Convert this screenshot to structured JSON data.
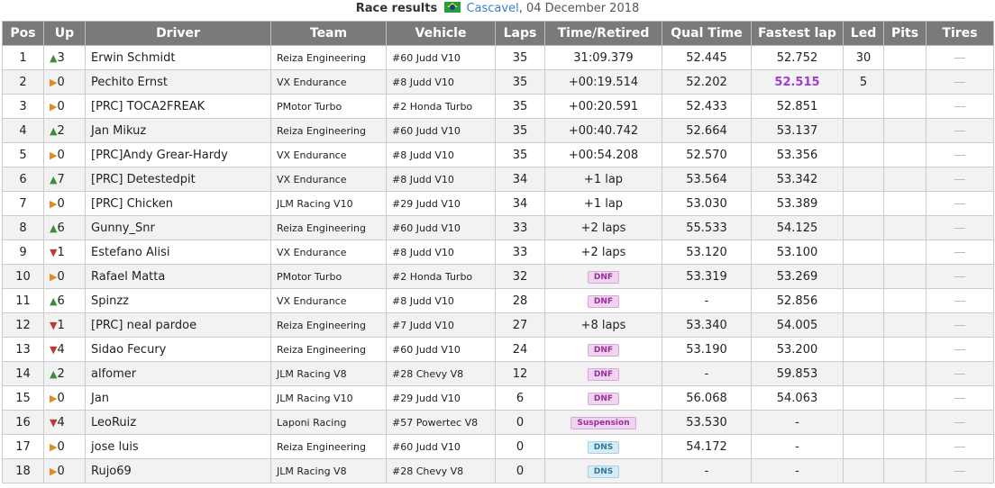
{
  "caption": {
    "title": "Race results",
    "track": "Cascavel",
    "date": ", 04 December 2018"
  },
  "headers": [
    "Pos",
    "Up",
    "Driver",
    "Team",
    "Vehicle",
    "Laps",
    "Time/Retired",
    "Qual Time",
    "Fastest lap",
    "Led",
    "Pits",
    "Tires"
  ],
  "colors": {
    "header_bg": "#7a7a7a",
    "up": "#3a8e3a",
    "down": "#c0392b",
    "same": "#e08a1e",
    "fastest": "#a23bd6"
  },
  "rows": [
    {
      "pos": "1",
      "dir": "up",
      "change": "3",
      "driver": "Erwin Schmidt",
      "team": "Reiza Engineering",
      "vehicle": "#60 Judd V10",
      "laps": "35",
      "time": "31:09.379",
      "badge": "",
      "qual": "52.445",
      "fastest": "52.752",
      "fastest_best": false,
      "led": "30",
      "pits": "",
      "tires": "—"
    },
    {
      "pos": "2",
      "dir": "same",
      "change": "0",
      "driver": "Pechito Ernst",
      "team": "VX Endurance",
      "vehicle": "#8 Judd V10",
      "laps": "35",
      "time": "+00:19.514",
      "badge": "",
      "qual": "52.202",
      "fastest": "52.515",
      "fastest_best": true,
      "led": "5",
      "pits": "",
      "tires": "—"
    },
    {
      "pos": "3",
      "dir": "same",
      "change": "0",
      "driver": "[PRC] TOCA2FREAK",
      "team": "PMotor Turbo",
      "vehicle": "#2 Honda Turbo",
      "laps": "35",
      "time": "+00:20.591",
      "badge": "",
      "qual": "52.433",
      "fastest": "52.851",
      "fastest_best": false,
      "led": "",
      "pits": "",
      "tires": "—"
    },
    {
      "pos": "4",
      "dir": "up",
      "change": "2",
      "driver": "Jan Mikuz",
      "team": "Reiza Engineering",
      "vehicle": "#60 Judd V10",
      "laps": "35",
      "time": "+00:40.742",
      "badge": "",
      "qual": "52.664",
      "fastest": "53.137",
      "fastest_best": false,
      "led": "",
      "pits": "",
      "tires": "—"
    },
    {
      "pos": "5",
      "dir": "same",
      "change": "0",
      "driver": "[PRC]Andy Grear-Hardy",
      "team": "VX Endurance",
      "vehicle": "#8 Judd V10",
      "laps": "35",
      "time": "+00:54.208",
      "badge": "",
      "qual": "52.570",
      "fastest": "53.356",
      "fastest_best": false,
      "led": "",
      "pits": "",
      "tires": "—"
    },
    {
      "pos": "6",
      "dir": "up",
      "change": "7",
      "driver": "[PRC] Detestedpit",
      "team": "VX Endurance",
      "vehicle": "#8 Judd V10",
      "laps": "34",
      "time": "+1 lap",
      "badge": "",
      "qual": "53.564",
      "fastest": "53.342",
      "fastest_best": false,
      "led": "",
      "pits": "",
      "tires": "—"
    },
    {
      "pos": "7",
      "dir": "same",
      "change": "0",
      "driver": "[PRC] Chicken",
      "team": "JLM Racing V10",
      "vehicle": "#29 Judd V10",
      "laps": "34",
      "time": "+1 lap",
      "badge": "",
      "qual": "53.030",
      "fastest": "53.389",
      "fastest_best": false,
      "led": "",
      "pits": "",
      "tires": "—"
    },
    {
      "pos": "8",
      "dir": "up",
      "change": "6",
      "driver": "Gunny_Snr",
      "team": "Reiza Engineering",
      "vehicle": "#60 Judd V10",
      "laps": "33",
      "time": "+2 laps",
      "badge": "",
      "qual": "55.533",
      "fastest": "54.125",
      "fastest_best": false,
      "led": "",
      "pits": "",
      "tires": "—"
    },
    {
      "pos": "9",
      "dir": "down",
      "change": "1",
      "driver": "Estefano Alisi",
      "team": "VX Endurance",
      "vehicle": "#8 Judd V10",
      "laps": "33",
      "time": "+2 laps",
      "badge": "",
      "qual": "53.120",
      "fastest": "53.100",
      "fastest_best": false,
      "led": "",
      "pits": "",
      "tires": "—"
    },
    {
      "pos": "10",
      "dir": "same",
      "change": "0",
      "driver": "Rafael Matta",
      "team": "PMotor Turbo",
      "vehicle": "#2 Honda Turbo",
      "laps": "32",
      "time": "",
      "badge": "DNF",
      "qual": "53.319",
      "fastest": "53.269",
      "fastest_best": false,
      "led": "",
      "pits": "",
      "tires": "—"
    },
    {
      "pos": "11",
      "dir": "up",
      "change": "6",
      "driver": "Spinzz",
      "team": "VX Endurance",
      "vehicle": "#8 Judd V10",
      "laps": "28",
      "time": "",
      "badge": "DNF",
      "qual": "-",
      "fastest": "52.856",
      "fastest_best": false,
      "led": "",
      "pits": "",
      "tires": "—"
    },
    {
      "pos": "12",
      "dir": "down",
      "change": "1",
      "driver": "[PRC] neal pardoe",
      "team": "Reiza Engineering",
      "vehicle": "#7 Judd V10",
      "laps": "27",
      "time": "+8 laps",
      "badge": "",
      "qual": "53.340",
      "fastest": "54.005",
      "fastest_best": false,
      "led": "",
      "pits": "",
      "tires": "—"
    },
    {
      "pos": "13",
      "dir": "down",
      "change": "4",
      "driver": "Sidao Fecury",
      "team": "Reiza Engineering",
      "vehicle": "#60 Judd V10",
      "laps": "24",
      "time": "",
      "badge": "DNF",
      "qual": "53.190",
      "fastest": "53.200",
      "fastest_best": false,
      "led": "",
      "pits": "",
      "tires": "—"
    },
    {
      "pos": "14",
      "dir": "up",
      "change": "2",
      "driver": "alfomer",
      "team": "JLM Racing V8",
      "vehicle": "#28 Chevy V8",
      "laps": "12",
      "time": "",
      "badge": "DNF",
      "qual": "-",
      "fastest": "59.853",
      "fastest_best": false,
      "led": "",
      "pits": "",
      "tires": "—"
    },
    {
      "pos": "15",
      "dir": "same",
      "change": "0",
      "driver": "Jan",
      "team": "JLM Racing V10",
      "vehicle": "#29 Judd V10",
      "laps": "6",
      "time": "",
      "badge": "DNF",
      "qual": "56.068",
      "fastest": "54.063",
      "fastest_best": false,
      "led": "",
      "pits": "",
      "tires": "—"
    },
    {
      "pos": "16",
      "dir": "down",
      "change": "4",
      "driver": "LeoRuiz",
      "team": "Laponi Racing",
      "vehicle": "#57 Powertec V8",
      "laps": "0",
      "time": "",
      "badge": "Suspension",
      "qual": "53.530",
      "fastest": "-",
      "fastest_best": false,
      "led": "",
      "pits": "",
      "tires": "—"
    },
    {
      "pos": "17",
      "dir": "same",
      "change": "0",
      "driver": "jose luis",
      "team": "Reiza Engineering",
      "vehicle": "#60 Judd V10",
      "laps": "0",
      "time": "",
      "badge": "DNS",
      "qual": "54.172",
      "fastest": "-",
      "fastest_best": false,
      "led": "",
      "pits": "",
      "tires": "—"
    },
    {
      "pos": "18",
      "dir": "same",
      "change": "0",
      "driver": "Rujo69",
      "team": "JLM Racing V8",
      "vehicle": "#28 Chevy V8",
      "laps": "0",
      "time": "",
      "badge": "DNS",
      "qual": "-",
      "fastest": "-",
      "fastest_best": false,
      "led": "",
      "pits": "",
      "tires": "—"
    }
  ]
}
